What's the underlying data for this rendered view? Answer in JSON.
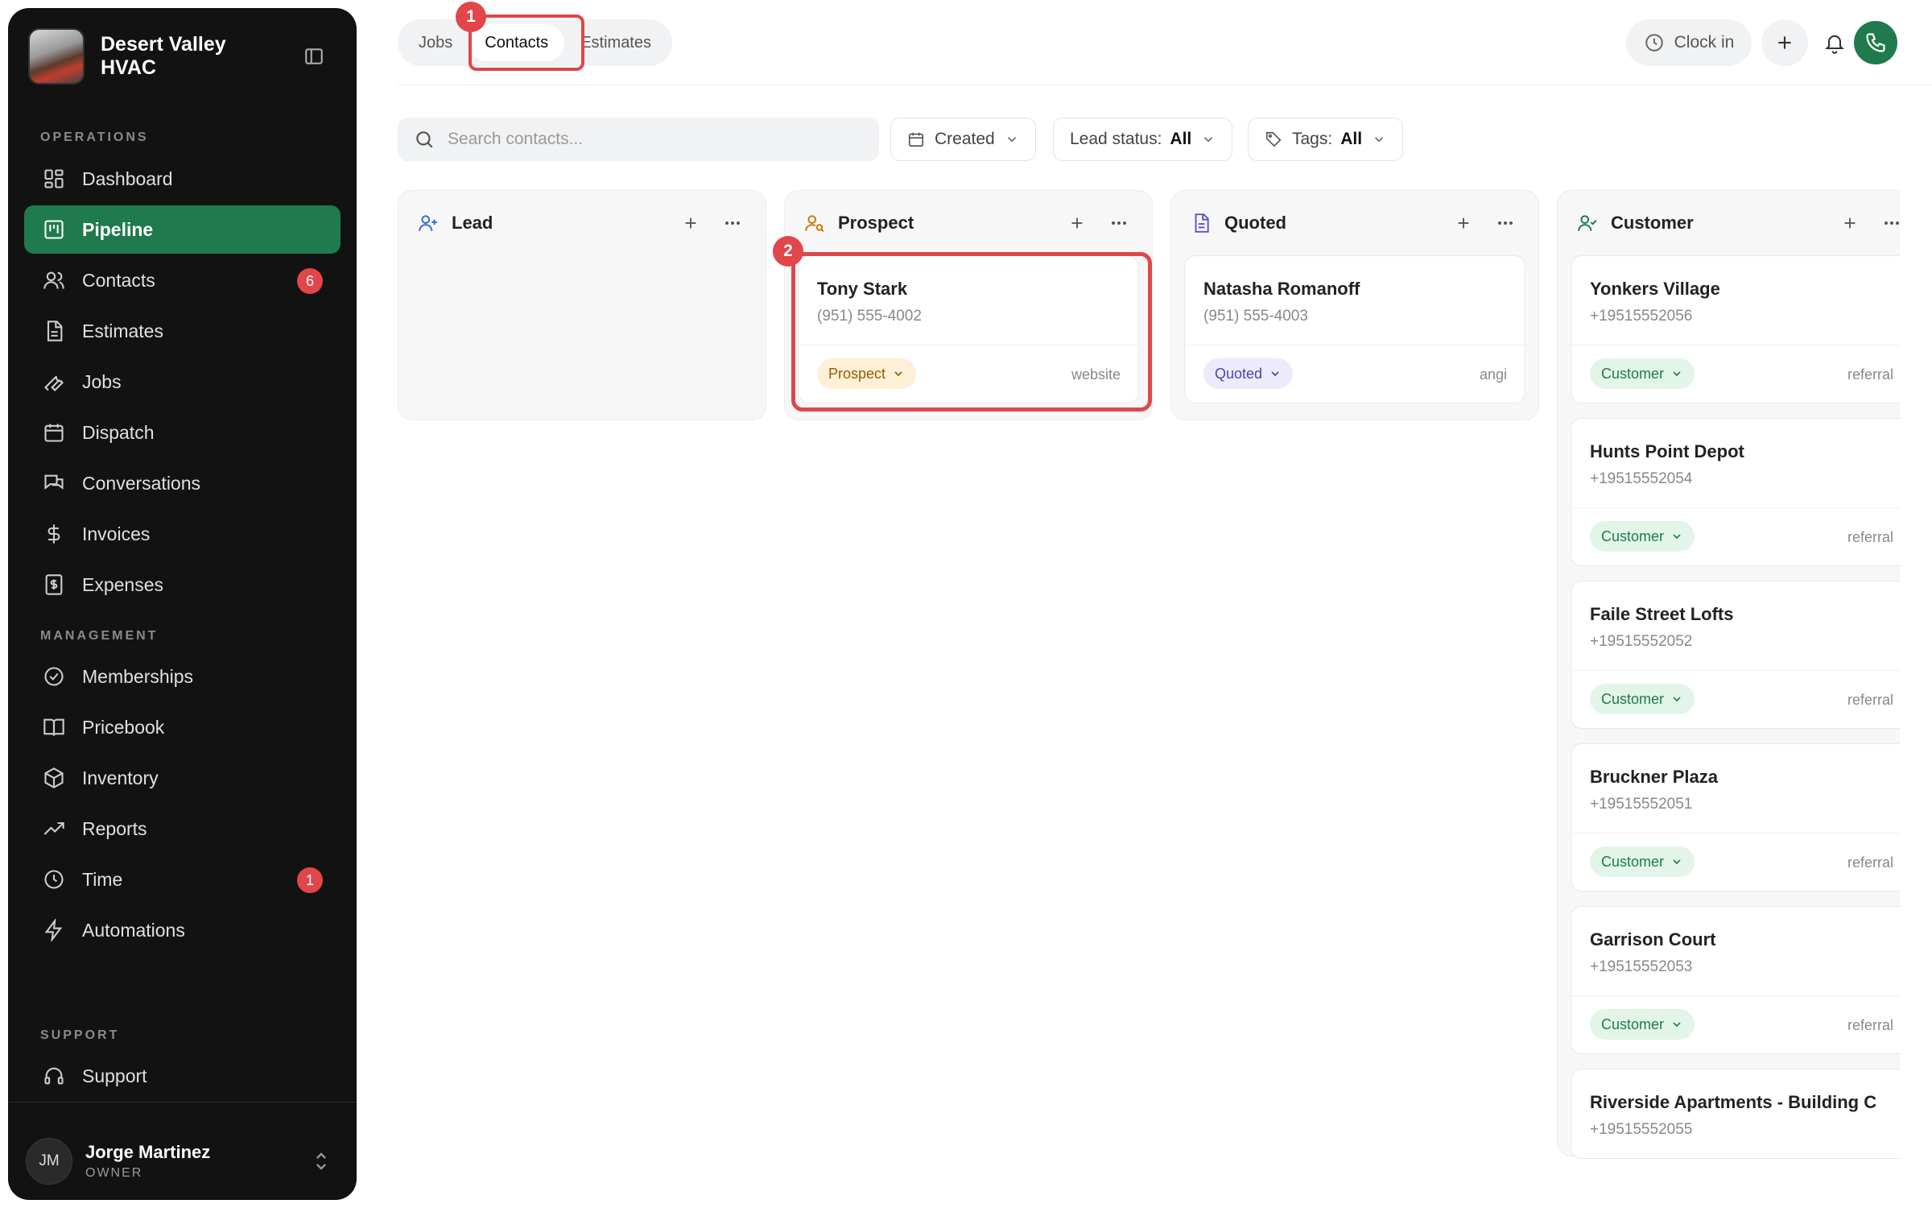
{
  "sidebar": {
    "brand": {
      "name": "Desert Valley HVAC"
    },
    "sections": {
      "operations": "OPERATIONS",
      "management": "MANAGEMENT",
      "support": "SUPPORT"
    },
    "items": [
      {
        "label": "Dashboard",
        "icon": "dashboard-icon"
      },
      {
        "label": "Pipeline",
        "icon": "pipeline-icon",
        "active": true
      },
      {
        "label": "Contacts",
        "icon": "users-icon",
        "badge": "6"
      },
      {
        "label": "Estimates",
        "icon": "document-icon"
      },
      {
        "label": "Jobs",
        "icon": "wrench-icon"
      },
      {
        "label": "Dispatch",
        "icon": "calendar-icon"
      },
      {
        "label": "Conversations",
        "icon": "chat-icon"
      },
      {
        "label": "Invoices",
        "icon": "dollar-icon"
      },
      {
        "label": "Expenses",
        "icon": "receipt-icon"
      },
      {
        "label": "Memberships",
        "icon": "badge-check-icon"
      },
      {
        "label": "Pricebook",
        "icon": "book-icon"
      },
      {
        "label": "Inventory",
        "icon": "box-icon"
      },
      {
        "label": "Reports",
        "icon": "trend-icon"
      },
      {
        "label": "Time",
        "icon": "clock-icon",
        "badge": "1"
      },
      {
        "label": "Automations",
        "icon": "bolt-icon"
      },
      {
        "label": "Support",
        "icon": "headset-icon"
      }
    ],
    "user": {
      "initials": "JM",
      "name": "Jorge Martinez",
      "role": "OWNER"
    }
  },
  "topbar": {
    "tabs": [
      {
        "label": "Jobs"
      },
      {
        "label": "Contacts",
        "active": true
      },
      {
        "label": "Estimates"
      }
    ],
    "clock_label": "Clock in",
    "steps": {
      "one": "1",
      "two": "2"
    }
  },
  "filters": {
    "search_placeholder": "Search contacts...",
    "created_label": "Created",
    "lead_status_label": "Lead status:",
    "lead_status_value": "All",
    "tags_label": "Tags:",
    "tags_value": "All"
  },
  "board": {
    "columns": [
      {
        "title": "Lead",
        "icon": "user-plus-icon",
        "cards": []
      },
      {
        "title": "Prospect",
        "icon": "user-search-icon",
        "cards": [
          {
            "name": "Tony Stark",
            "phone": "(951) 555-4002",
            "status": "Prospect",
            "source": "website"
          }
        ]
      },
      {
        "title": "Quoted",
        "icon": "document-icon",
        "cards": [
          {
            "name": "Natasha Romanoff",
            "phone": "(951) 555-4003",
            "status": "Quoted",
            "source": "angi"
          }
        ]
      },
      {
        "title": "Customer",
        "icon": "user-check-icon",
        "cards": [
          {
            "name": "Yonkers Village",
            "phone": "+19515552056",
            "status": "Customer",
            "source": "referral"
          },
          {
            "name": "Hunts Point Depot",
            "phone": "+19515552054",
            "status": "Customer",
            "source": "referral"
          },
          {
            "name": "Faile Street Lofts",
            "phone": "+19515552052",
            "status": "Customer",
            "source": "referral"
          },
          {
            "name": "Bruckner Plaza",
            "phone": "+19515552051",
            "status": "Customer",
            "source": "referral"
          },
          {
            "name": "Garrison Court",
            "phone": "+19515552053",
            "status": "Customer",
            "source": "referral"
          },
          {
            "name": "Riverside Apartments - Building C",
            "phone": "+19515552055"
          }
        ]
      }
    ]
  },
  "colors": {
    "accent": "#1f7a4d",
    "highlight": "#e0464a",
    "sidebar_bg": "#121212"
  }
}
